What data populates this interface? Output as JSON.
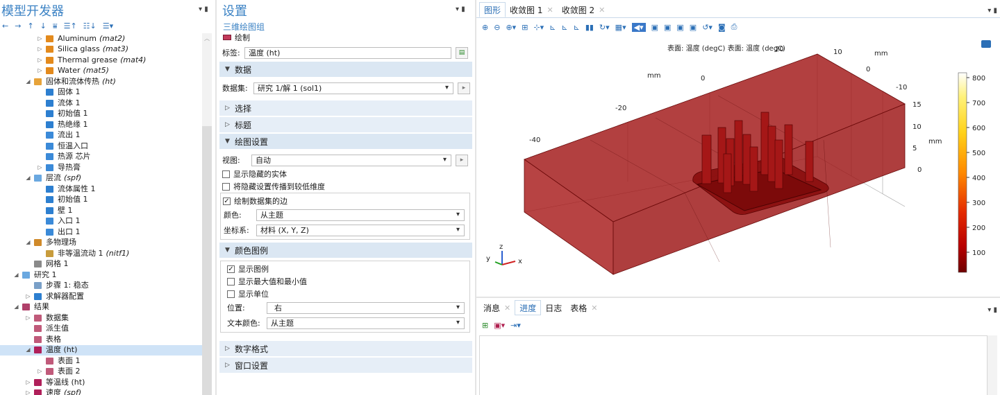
{
  "left": {
    "title": "模型开发器",
    "tree": [
      {
        "indent": 1,
        "tw": "▷",
        "icon": "material-icon",
        "color": "#e38a1d",
        "label": "Aluminum",
        "tag": "(mat2)"
      },
      {
        "indent": 1,
        "tw": "▷",
        "icon": "material-icon",
        "color": "#e38a1d",
        "label": "Silica glass",
        "tag": "(mat3)"
      },
      {
        "indent": 1,
        "tw": "▷",
        "icon": "material-icon",
        "color": "#e38a1d",
        "label": "Thermal grease",
        "tag": "(mat4)"
      },
      {
        "indent": 1,
        "tw": "▷",
        "icon": "material-icon",
        "color": "#e38a1d",
        "label": "Water",
        "tag": "(mat5)"
      },
      {
        "indent": 0,
        "tw": "◢",
        "icon": "heat-transfer-icon",
        "color": "#e7a33a",
        "label": "固体和流体传热",
        "tag": "(ht)"
      },
      {
        "indent": 1,
        "tw": "",
        "icon": "domain-icon",
        "color": "#2d7fd0",
        "label": "固体 1",
        "tag": ""
      },
      {
        "indent": 1,
        "tw": "",
        "icon": "domain-icon",
        "color": "#2d7fd0",
        "label": "流体 1",
        "tag": ""
      },
      {
        "indent": 1,
        "tw": "",
        "icon": "domain-icon",
        "color": "#2d7fd0",
        "label": "初始值 1",
        "tag": ""
      },
      {
        "indent": 1,
        "tw": "",
        "icon": "domain-icon",
        "color": "#2d7fd0",
        "label": "热绝缘 1",
        "tag": ""
      },
      {
        "indent": 1,
        "tw": "",
        "icon": "boundary-icon",
        "color": "#3b8ad8",
        "label": "流出 1",
        "tag": ""
      },
      {
        "indent": 1,
        "tw": "",
        "icon": "boundary-icon",
        "color": "#3b8ad8",
        "label": "恒温入口",
        "tag": ""
      },
      {
        "indent": 1,
        "tw": "",
        "icon": "boundary-icon",
        "color": "#3b8ad8",
        "label": "热源 芯片",
        "tag": ""
      },
      {
        "indent": 1,
        "tw": "▷",
        "icon": "boundary-icon",
        "color": "#3b8ad8",
        "label": "导热膏",
        "tag": ""
      },
      {
        "indent": 0,
        "tw": "◢",
        "icon": "laminar-flow-icon",
        "color": "#6aa8e0",
        "label": "层流",
        "tag": "(spf)"
      },
      {
        "indent": 1,
        "tw": "",
        "icon": "domain-icon",
        "color": "#2d7fd0",
        "label": "流体属性 1",
        "tag": ""
      },
      {
        "indent": 1,
        "tw": "",
        "icon": "domain-icon",
        "color": "#2d7fd0",
        "label": "初始值 1",
        "tag": ""
      },
      {
        "indent": 1,
        "tw": "",
        "icon": "domain-icon",
        "color": "#2d7fd0",
        "label": "壁 1",
        "tag": ""
      },
      {
        "indent": 1,
        "tw": "",
        "icon": "boundary-icon",
        "color": "#3b8ad8",
        "label": "入口 1",
        "tag": ""
      },
      {
        "indent": 1,
        "tw": "",
        "icon": "boundary-icon",
        "color": "#3b8ad8",
        "label": "出口 1",
        "tag": ""
      },
      {
        "indent": 0,
        "tw": "◢",
        "icon": "multiphysics-icon",
        "color": "#d08a2a",
        "label": "多物理场",
        "tag": ""
      },
      {
        "indent": 1,
        "tw": "",
        "icon": "coupling-icon",
        "color": "#c89c3c",
        "label": "非等温流动 1",
        "tag": "(nitf1)"
      },
      {
        "indent": 0,
        "tw": "",
        "icon": "mesh-icon",
        "color": "#8a8a8a",
        "label": "网格 1",
        "tag": ""
      },
      {
        "indent": -1,
        "tw": "◢",
        "icon": "study-icon",
        "color": "#6aa8e0",
        "label": "研究 1",
        "tag": ""
      },
      {
        "indent": 0,
        "tw": "",
        "icon": "step-icon",
        "color": "#7aa0c8",
        "label": "步骤 1: 稳态",
        "tag": ""
      },
      {
        "indent": 0,
        "tw": "▷",
        "icon": "solver-icon",
        "color": "#2d7fd0",
        "label": "求解器配置",
        "tag": ""
      },
      {
        "indent": -1,
        "tw": "◢",
        "icon": "results-icon",
        "color": "#b0406a",
        "label": "结果",
        "tag": ""
      },
      {
        "indent": 0,
        "tw": "▷",
        "icon": "dataset-icon",
        "color": "#c05a7a",
        "label": "数据集",
        "tag": ""
      },
      {
        "indent": 0,
        "tw": "",
        "icon": "derived-values-icon",
        "color": "#c05a7a",
        "label": "派生值",
        "tag": ""
      },
      {
        "indent": 0,
        "tw": "",
        "icon": "table-icon",
        "color": "#c05a7a",
        "label": "表格",
        "tag": ""
      },
      {
        "indent": 0,
        "tw": "◢",
        "icon": "plot-group-icon",
        "color": "#b0205a",
        "label": "温度 (ht)",
        "tag": "",
        "sel": true
      },
      {
        "indent": 1,
        "tw": "",
        "icon": "surface-icon",
        "color": "#c05a7a",
        "label": "表面 1",
        "tag": ""
      },
      {
        "indent": 1,
        "tw": "▷",
        "icon": "surface-icon",
        "color": "#c05a7a",
        "label": "表面 2",
        "tag": ""
      },
      {
        "indent": 0,
        "tw": "▷",
        "icon": "plot-group-icon",
        "color": "#b0205a",
        "label": "等温线 (ht)",
        "tag": ""
      },
      {
        "indent": 0,
        "tw": "▷",
        "icon": "plot-group-icon",
        "color": "#b0205a",
        "label": "速度",
        "tag": "(spf)"
      }
    ]
  },
  "mid": {
    "title": "设置",
    "subtitle": "三维绘图组",
    "plot_label": "绘制",
    "label_label": "标签:",
    "label_value": "温度 (ht)",
    "sec_data": "数据",
    "dataset_label": "数据集:",
    "dataset_value": "研究 1/解 1 (sol1)",
    "sec_select": "选择",
    "sec_title": "标题",
    "sec_plotsettings": "绘图设置",
    "view_label": "视图:",
    "view_value": "自动",
    "cb_hidden": "显示隐藏的实体",
    "cb_propagate": "将隐藏设置传播到较低维度",
    "cb_edges": "绘制数据集的边",
    "color_label": "颜色:",
    "color_value": "从主题",
    "frame_label": "坐标系:",
    "frame_value": "材料 (X, Y, Z)",
    "sec_legend": "颜色图例",
    "cb_legend": "显示图例",
    "cb_minmax": "显示最大值和最小值",
    "cb_units": "显示单位",
    "pos_label": "位置:",
    "pos_value": "右",
    "textcolor_label": "文本颜色:",
    "textcolor_value": "从主题",
    "sec_number": "数字格式",
    "sec_window": "窗口设置"
  },
  "right": {
    "tabs": [
      "图形",
      "收敛图 1",
      "收敛图 2"
    ],
    "plot_title": "表面: 温度 (degC)  表面: 温度 (degC)",
    "x_unit": "mm",
    "y_unit": "mm",
    "z_unit": "mm",
    "x_ticks": [
      "-40",
      "-20",
      "0"
    ],
    "y_ticks": [
      "20",
      "10",
      "0",
      "-10"
    ],
    "z_ticks": [
      "15",
      "10",
      "5",
      "0"
    ],
    "legend_ticks": [
      "800",
      "700",
      "600",
      "500",
      "400",
      "300",
      "200",
      "100"
    ],
    "axis_x": "x",
    "axis_y": "y",
    "axis_z": "z",
    "lower_tabs": [
      "消息",
      "进度",
      "日志",
      "表格"
    ]
  }
}
